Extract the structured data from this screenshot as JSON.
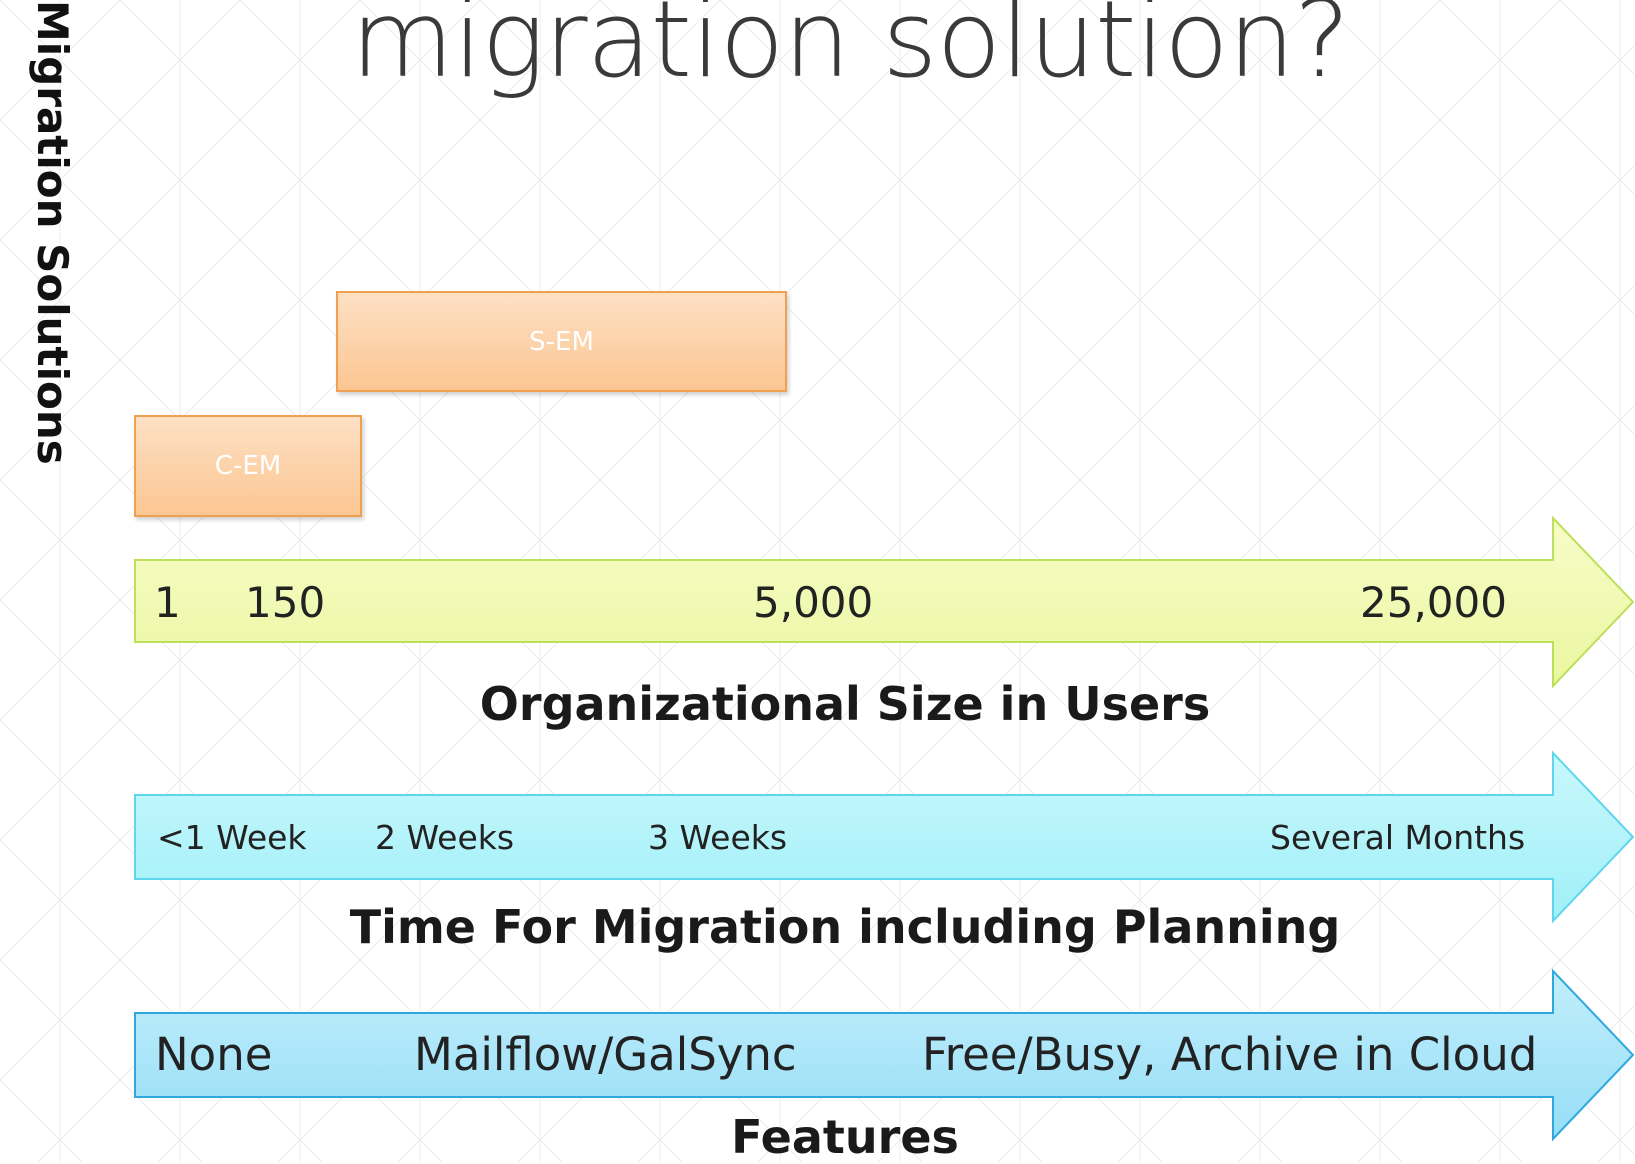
{
  "slide": {
    "title": "migration solution?",
    "side_label": "Migration Solutions"
  },
  "solutions": [
    {
      "label": "S-EM"
    },
    {
      "label": "C-EM"
    }
  ],
  "size_axis": {
    "ticks": [
      "1",
      "150",
      "5,000",
      "25,000"
    ],
    "title": "Organizational Size in Users",
    "color": "#f2fbb0"
  },
  "time_axis": {
    "ticks": [
      "<1 Week",
      "2 Weeks",
      "3 Weeks",
      "Several Months"
    ],
    "title": "Time For Migration including Planning",
    "color": "#aef4fb"
  },
  "features_axis": {
    "ticks": [
      "None",
      "Mailflow/GalSync",
      "Free/Busy, Archive in Cloud"
    ],
    "title": "Features",
    "color": "#a6e6fa"
  },
  "colors": {
    "box_fill": "#fcc692",
    "box_border": "#f0a050",
    "size_arrow_border": "#bde05a",
    "time_arrow_border": "#5fd6ee",
    "features_arrow_border": "#2fa8e0"
  }
}
